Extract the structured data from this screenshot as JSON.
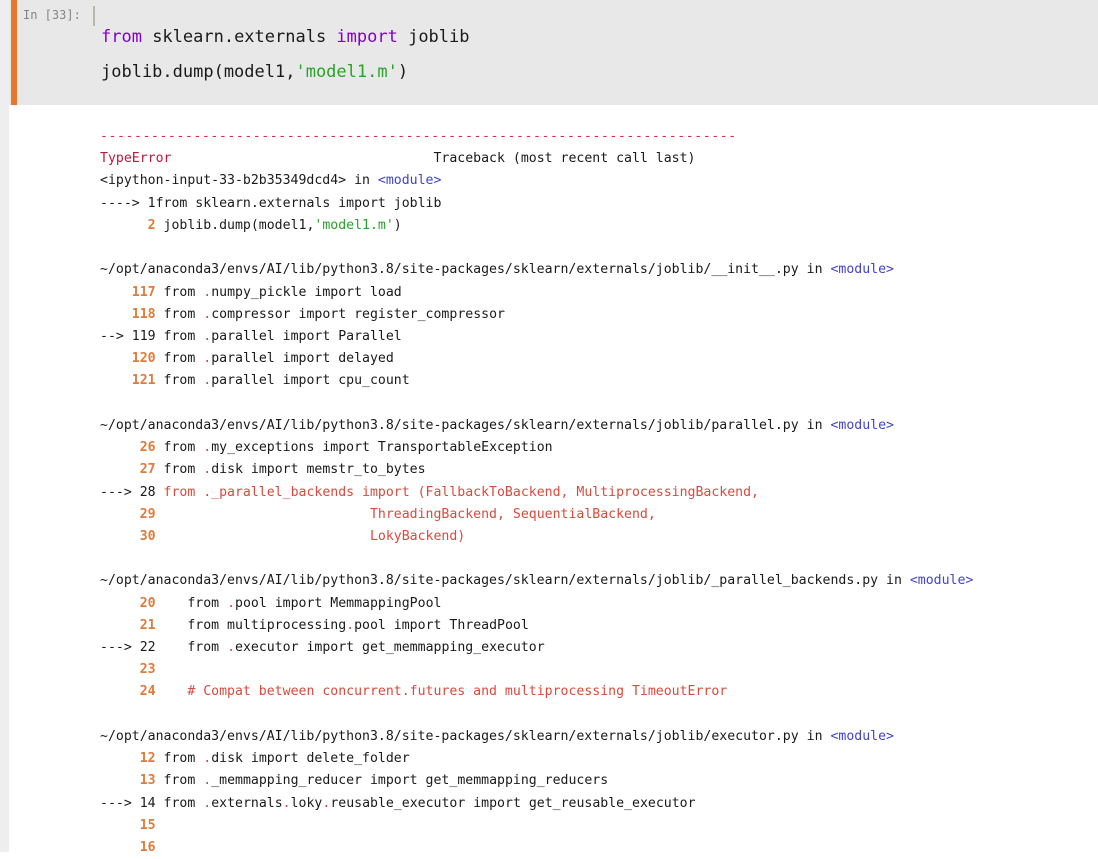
{
  "notebook": {
    "cell": {
      "prompt": "In [33]:",
      "execution_count": 33,
      "code_lines": [
        {
          "tokens": [
            {
              "text": "from ",
              "style": "kw"
            },
            {
              "text": "sklearn.externals ",
              "style": "plain"
            },
            {
              "text": "import ",
              "style": "kw"
            },
            {
              "text": "joblib",
              "style": "plain"
            }
          ]
        },
        {
          "tokens": [
            {
              "text": "joblib.dump(model1,",
              "style": "plain"
            },
            {
              "text": "'model1.m'",
              "style": "str"
            },
            {
              "text": ")",
              "style": "plain"
            }
          ]
        }
      ]
    },
    "output": {
      "separator": "---------------------------------------------------------------------------",
      "exception_name": "TypeError",
      "traceback_header": "Traceback (most recent call last)",
      "frames": [
        {
          "location": "<ipython-input-33-b2b35349dcd4>",
          "location_suffix": " in ",
          "scope": "<module>",
          "lines": [
            {
              "marker": "----> ",
              "number": "1",
              "marker_style": "plain",
              "number_style": "plain",
              "tokens": [
                {
                  "text": "from sklearn.externals import joblib",
                  "style": "plain"
                }
              ]
            },
            {
              "marker": "      ",
              "number": "2",
              "marker_style": "plain",
              "number_style": "lineno",
              "tokens": [
                {
                  "text": " joblib.dump(model1,",
                  "style": "plain"
                },
                {
                  "text": "'model1.m'",
                  "style": "str"
                },
                {
                  "text": ")",
                  "style": "plain"
                }
              ]
            }
          ]
        },
        {
          "location": "~/opt/anaconda3/envs/AI/lib/python3.8/site-packages/sklearn/externals/joblib/__init__.py",
          "location_suffix": " in ",
          "scope": "<module>",
          "lines": [
            {
              "marker": "    ",
              "number": "117",
              "marker_style": "plain",
              "number_style": "lineno",
              "tokens": [
                {
                  "text": " from ",
                  "style": "plain"
                },
                {
                  "text": ".",
                  "style": "dot"
                },
                {
                  "text": "numpy_pickle import load",
                  "style": "plain"
                }
              ]
            },
            {
              "marker": "    ",
              "number": "118",
              "marker_style": "plain",
              "number_style": "lineno",
              "tokens": [
                {
                  "text": " from ",
                  "style": "plain"
                },
                {
                  "text": ".",
                  "style": "dot"
                },
                {
                  "text": "compressor import register_compressor",
                  "style": "plain"
                }
              ]
            },
            {
              "marker": "--> ",
              "number": "119",
              "marker_style": "plain",
              "number_style": "plain",
              "tokens": [
                {
                  "text": " from ",
                  "style": "plain"
                },
                {
                  "text": ".",
                  "style": "dot"
                },
                {
                  "text": "parallel import Parallel",
                  "style": "plain"
                }
              ]
            },
            {
              "marker": "    ",
              "number": "120",
              "marker_style": "plain",
              "number_style": "lineno",
              "tokens": [
                {
                  "text": " from ",
                  "style": "plain"
                },
                {
                  "text": ".",
                  "style": "dot"
                },
                {
                  "text": "parallel import delayed",
                  "style": "plain"
                }
              ]
            },
            {
              "marker": "    ",
              "number": "121",
              "marker_style": "plain",
              "number_style": "lineno",
              "tokens": [
                {
                  "text": " from ",
                  "style": "plain"
                },
                {
                  "text": ".",
                  "style": "dot"
                },
                {
                  "text": "parallel import cpu_count",
                  "style": "plain"
                }
              ]
            }
          ]
        },
        {
          "location": "~/opt/anaconda3/envs/AI/lib/python3.8/site-packages/sklearn/externals/joblib/parallel.py",
          "location_suffix": " in ",
          "scope": "<module>",
          "lines": [
            {
              "marker": "     ",
              "number": "26",
              "marker_style": "plain",
              "number_style": "lineno",
              "tokens": [
                {
                  "text": " from ",
                  "style": "plain"
                },
                {
                  "text": ".",
                  "style": "dot"
                },
                {
                  "text": "my_exceptions import TransportableException",
                  "style": "plain"
                }
              ]
            },
            {
              "marker": "     ",
              "number": "27",
              "marker_style": "plain",
              "number_style": "lineno",
              "tokens": [
                {
                  "text": " from ",
                  "style": "plain"
                },
                {
                  "text": ".",
                  "style": "dot"
                },
                {
                  "text": "disk import memstr_to_bytes",
                  "style": "plain"
                }
              ]
            },
            {
              "marker": "---> ",
              "number": "28",
              "marker_style": "plain",
              "number_style": "plain",
              "tokens": [
                {
                  "text": " from ._parallel_backends import (FallbackToBackend, MultiprocessingBackend,",
                  "style": "errline"
                }
              ]
            },
            {
              "marker": "     ",
              "number": "29",
              "marker_style": "plain",
              "number_style": "lineno",
              "tokens": [
                {
                  "text": "                           ThreadingBackend, SequentialBackend,",
                  "style": "errline"
                }
              ]
            },
            {
              "marker": "     ",
              "number": "30",
              "marker_style": "plain",
              "number_style": "lineno",
              "tokens": [
                {
                  "text": "                           LokyBackend)",
                  "style": "errline"
                }
              ]
            }
          ]
        },
        {
          "location": "~/opt/anaconda3/envs/AI/lib/python3.8/site-packages/sklearn/externals/joblib/_parallel_backends.py",
          "location_suffix": " in ",
          "scope": "<module>",
          "lines": [
            {
              "marker": "     ",
              "number": "20",
              "marker_style": "plain",
              "number_style": "lineno",
              "tokens": [
                {
                  "text": "    from ",
                  "style": "plain"
                },
                {
                  "text": ".",
                  "style": "dot"
                },
                {
                  "text": "pool import MemmappingPool",
                  "style": "plain"
                }
              ]
            },
            {
              "marker": "     ",
              "number": "21",
              "marker_style": "plain",
              "number_style": "lineno",
              "tokens": [
                {
                  "text": "    from multiprocessing",
                  "style": "plain"
                },
                {
                  "text": ".",
                  "style": "dot"
                },
                {
                  "text": "pool import ThreadPool",
                  "style": "plain"
                }
              ]
            },
            {
              "marker": "---> ",
              "number": "22",
              "marker_style": "plain",
              "number_style": "plain",
              "tokens": [
                {
                  "text": "    from ",
                  "style": "plain"
                },
                {
                  "text": ".",
                  "style": "dot"
                },
                {
                  "text": "executor import get_memmapping_executor",
                  "style": "plain"
                }
              ]
            },
            {
              "marker": "     ",
              "number": "23",
              "marker_style": "plain",
              "number_style": "lineno",
              "tokens": [
                {
                  "text": "",
                  "style": "plain"
                }
              ]
            },
            {
              "marker": "     ",
              "number": "24",
              "marker_style": "plain",
              "number_style": "lineno",
              "tokens": [
                {
                  "text": "    # Compat between concurrent.futures and multiprocessing TimeoutError",
                  "style": "comment"
                }
              ]
            }
          ]
        },
        {
          "location": "~/opt/anaconda3/envs/AI/lib/python3.8/site-packages/sklearn/externals/joblib/executor.py",
          "location_suffix": " in ",
          "scope": "<module>",
          "lines": [
            {
              "marker": "     ",
              "number": "12",
              "marker_style": "plain",
              "number_style": "lineno",
              "tokens": [
                {
                  "text": " from ",
                  "style": "plain"
                },
                {
                  "text": ".",
                  "style": "dot"
                },
                {
                  "text": "disk import delete_folder",
                  "style": "plain"
                }
              ]
            },
            {
              "marker": "     ",
              "number": "13",
              "marker_style": "plain",
              "number_style": "lineno",
              "tokens": [
                {
                  "text": " from ",
                  "style": "plain"
                },
                {
                  "text": ".",
                  "style": "dot"
                },
                {
                  "text": "_memmapping_reducer import get_memmapping_reducers",
                  "style": "plain"
                }
              ]
            },
            {
              "marker": "---> ",
              "number": "14",
              "marker_style": "plain",
              "number_style": "plain",
              "tokens": [
                {
                  "text": " from ",
                  "style": "plain"
                },
                {
                  "text": ".",
                  "style": "dot"
                },
                {
                  "text": "externals",
                  "style": "plain"
                },
                {
                  "text": ".",
                  "style": "dot"
                },
                {
                  "text": "loky",
                  "style": "plain"
                },
                {
                  "text": ".",
                  "style": "dot"
                },
                {
                  "text": "reusable_executor import get_reusable_executor",
                  "style": "plain"
                }
              ]
            },
            {
              "marker": "     ",
              "number": "15",
              "marker_style": "plain",
              "number_style": "lineno",
              "tokens": [
                {
                  "text": "",
                  "style": "plain"
                }
              ]
            },
            {
              "marker": "     ",
              "number": "16",
              "marker_style": "plain",
              "number_style": "lineno",
              "tokens": [
                {
                  "text": "",
                  "style": "plain"
                }
              ]
            }
          ]
        }
      ]
    }
  },
  "colors": {
    "cell_background": "#e8e8e8",
    "selected_bar": "#e8762c",
    "keyword": "#8400c8",
    "string": "#2aa22a",
    "exception": "#c0173a",
    "module_tag": "#4242cc",
    "line_number": "#e07b39",
    "error_line": "#d94a3d",
    "separator": "#d92b41"
  }
}
